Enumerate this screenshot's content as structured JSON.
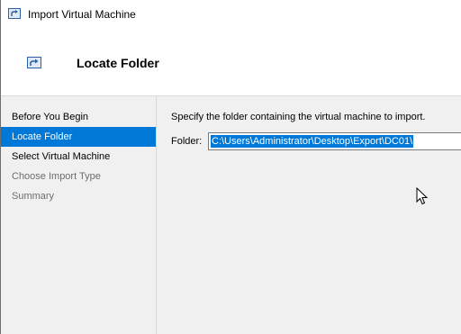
{
  "window": {
    "title": "Import Virtual Machine"
  },
  "header": {
    "title": "Locate Folder"
  },
  "nav": {
    "items": [
      {
        "label": "Before You Begin",
        "state": "normal"
      },
      {
        "label": "Locate Folder",
        "state": "active"
      },
      {
        "label": "Select Virtual Machine",
        "state": "normal"
      },
      {
        "label": "Choose Import Type",
        "state": "disabled"
      },
      {
        "label": "Summary",
        "state": "disabled"
      }
    ]
  },
  "main": {
    "instruction": "Specify the folder containing the virtual machine to import.",
    "folder_label": "Folder:",
    "folder_value": "C:\\Users\\Administrator\\Desktop\\Export\\DC01\\"
  },
  "colors": {
    "accent": "#0078d7",
    "disabled_text": "#6d6d6d"
  },
  "icons": {
    "title": "import-vm-icon",
    "header": "import-vm-icon",
    "pointer": "mouse-pointer-icon"
  }
}
